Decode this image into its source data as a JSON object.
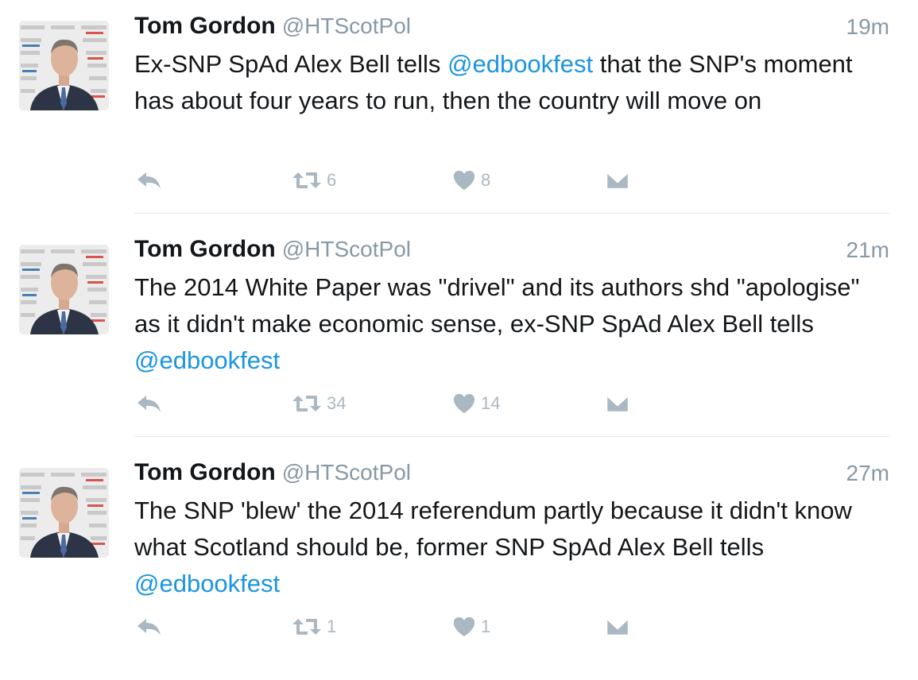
{
  "tweets": [
    {
      "name": "Tom Gordon",
      "handle": "@HTScotPol",
      "time": "19m",
      "text_before": "Ex-SNP SpAd Alex Bell tells ",
      "mention": "@edbookfest",
      "text_after": " that the SNP's moment has about four years to run, then the country will move on",
      "retweets": "6",
      "likes": "8"
    },
    {
      "name": "Tom Gordon",
      "handle": "@HTScotPol",
      "time": "21m",
      "text_before": "The 2014 White Paper was \"drivel\" and its authors shd \"apologise\" as it didn't make economic sense, ex-SNP SpAd Alex Bell tells ",
      "mention": "@edbookfest",
      "text_after": "",
      "retweets": "34",
      "likes": "14"
    },
    {
      "name": "Tom Gordon",
      "handle": "@HTScotPol",
      "time": "27m",
      "text_before": "The SNP 'blew' the 2014 referendum partly because it didn't know what Scotland should be, former SNP SpAd Alex Bell tells ",
      "mention": "@edbookfest",
      "text_after": "",
      "retweets": "1",
      "likes": "1"
    }
  ],
  "icons": {
    "reply": "reply-icon",
    "retweet": "retweet-icon",
    "like": "heart-icon",
    "message": "direct-message-icon"
  },
  "colors": {
    "mention": "#1b95e0",
    "secondary_text": "#8899a6",
    "action_icon": "#aab8c2",
    "divider": "#e1e8ed"
  }
}
